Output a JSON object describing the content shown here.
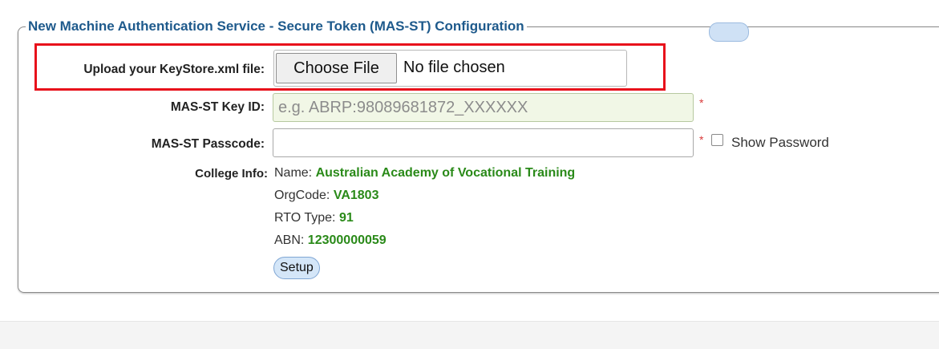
{
  "config": {
    "legend": "New Machine Authentication Service - Secure Token (MAS-ST) Configuration",
    "keystore_label": "Upload your KeyStore.xml file:",
    "choose_file_label": "Choose File",
    "file_status": "No file chosen",
    "key_id_label": "MAS-ST Key ID:",
    "key_id_placeholder": "e.g. ABRP:98089681872_XXXXXX",
    "key_id_value": "",
    "passcode_label": "MAS-ST Passcode:",
    "passcode_value": "",
    "required_mark": "*",
    "show_password_label": "Show Password",
    "show_password_checked": false,
    "college_info_label": "College Info:",
    "college": {
      "name_label": "Name:",
      "name": "Australian Academy of Vocational Training",
      "org_code_label": "OrgCode:",
      "org_code": "VA1803",
      "rto_type_label": "RTO Type:",
      "rto_type": "91",
      "abn_label": "ABN:",
      "abn": "12300000059"
    },
    "setup_label": "Setup"
  },
  "colors": {
    "legend_text": "#1e5a8c",
    "highlight_border": "#e8111b",
    "value_green": "#2a8a19",
    "required_red": "#d93a3a",
    "key_input_bg": "#f1f7e6"
  }
}
